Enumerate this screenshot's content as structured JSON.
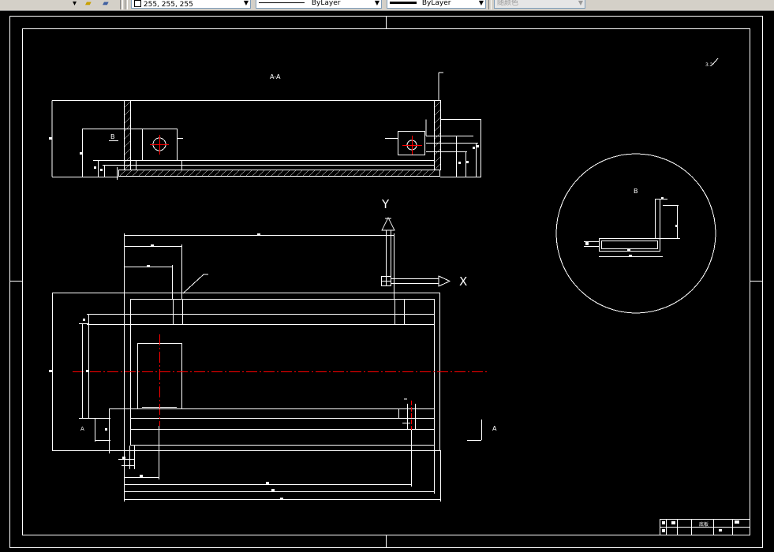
{
  "toolbar": {
    "color_value": "255, 255, 255",
    "linetype_value": "ByLayer",
    "lineweight_value": "ByLayer",
    "plotstyle_value": "随颜色"
  },
  "drawing": {
    "section_label": "A-A",
    "detail_label_big": "B",
    "detail_label_small": "B",
    "view_direction_label": "A",
    "left_letter": "A",
    "roughness_note": "3.2",
    "axis_x": "X",
    "axis_y": "Y",
    "title_block_name": "底板"
  },
  "colors": {
    "background": "#000000",
    "line": "#ffffff",
    "centerline": "#ff0000"
  }
}
